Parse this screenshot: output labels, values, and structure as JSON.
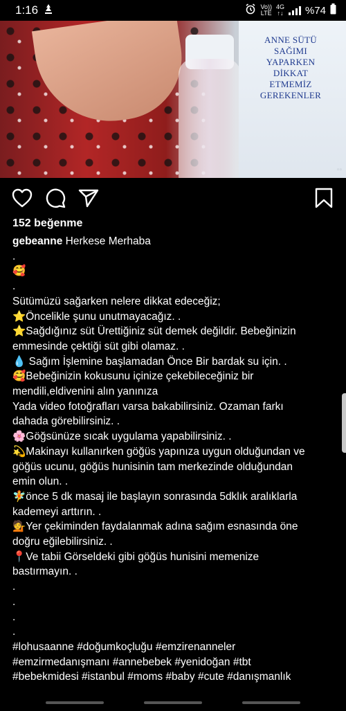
{
  "status_bar": {
    "time": "1:16",
    "volte_top": "Vo))",
    "volte_bottom": "LTE",
    "net_top": "4G",
    "battery": "%74"
  },
  "post": {
    "image_caption": "ANNE SÜTÜ\nSAĞIMI\nYAPARKEN\nDİKKAT\nETMEMİZ\nGEREKENLER",
    "likes": "152 beğenme",
    "username": "gebeanne",
    "caption_lines": [
      "Herkese Merhaba",
      ".",
      "🥰",
      ".",
      "Sütümüzü sağarken nelere dikkat edeceğiz;",
      "⭐Öncelikle şunu unutmayacağız. .",
      "⭐Sağdığınız süt Ürettiğiniz süt demek değildir. Bebeğinizin",
      "emmesinde çektiği süt gibi olamaz. .",
      "💧 Sağım İşlemine başlamadan Önce Bir bardak su için. .",
      "🥰Bebeğinizin kokusunu içinize çekebileceğiniz bir",
      "mendili,eldivenini alın yanınıza",
      "Yada video fotoğrafları varsa bakabilirsiniz. Ozaman farkı",
      "dahada görebilirsiniz. .",
      "🌸Göğsünüze sıcak uygulama yapabilirsiniz. .",
      "💫Makinayı kullanırken göğüs yapınıza uygun olduğundan ve",
      "göğüs ucunu, göğüs hunisinin tam merkezinde olduğundan",
      "emin olun. .",
      "🧚önce 5 dk masaj ile başlayın sonrasında 5dklık aralıklarla",
      "kademeyi arttırın. .",
      "💁Yer çekiminden faydalanmak adına sağım esnasında öne",
      "doğru eğilebilirsiniz. .",
      "📍Ve tabii Görseldeki gibi göğüs hunisini memenize",
      "bastırmayın. .",
      ".",
      ".",
      ".",
      ".",
      "#lohusaanne #doğumkoçluğu #emzirenanneler",
      "#emzirmedanışmanı #annebebek #yenidoğan #tbt",
      "#bebekmidesi #istanbul #moms #baby #cute #danışmanlık"
    ]
  }
}
